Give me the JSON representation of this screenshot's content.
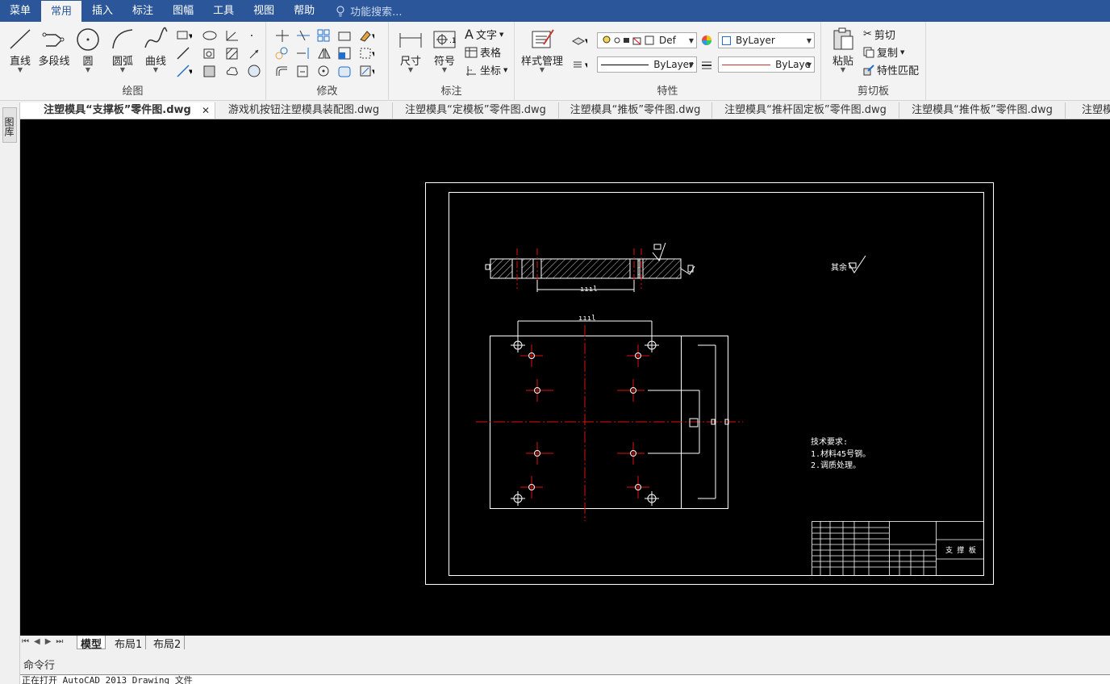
{
  "menubar": {
    "items": [
      "菜单",
      "常用",
      "插入",
      "标注",
      "图幅",
      "工具",
      "视图",
      "帮助"
    ],
    "search_placeholder": "功能搜索..."
  },
  "ribbon": {
    "draw": {
      "title": "绘图",
      "line": "直线",
      "polyline": "多段线",
      "circle": "圆",
      "arc": "圆弧",
      "curve": "曲线"
    },
    "modify": {
      "title": "修改"
    },
    "annotate": {
      "title": "标注",
      "dimension": "尺寸",
      "symbol": "符号",
      "text": "文字",
      "table": "表格",
      "coordinate": "坐标"
    },
    "properties": {
      "title": "特性",
      "style_manager": "样式管理",
      "layer_name": "Def",
      "bylayer1": "ByLayer",
      "bylayer2": "ByLayer",
      "bylayer3": "ByLaye"
    },
    "clipboard": {
      "title": "剪切板",
      "paste": "粘贴",
      "cut": "剪切",
      "copy": "复制",
      "match": "特性匹配"
    }
  },
  "tabs": [
    "注塑模具“支撑板”零件图.dwg",
    "游戏机按钮注塑模具装配图.dwg",
    "注塑模具“定模板”零件图.dwg",
    "注塑模具“推板”零件图.dwg",
    "注塑模具“推杆固定板”零件图.dwg",
    "注塑模具“推件板”零件图.dwg",
    "注塑模"
  ],
  "left_strip_label": "图库",
  "drawing": {
    "tech_title": "技术要求:",
    "tech_line1": "1.材料45号钢。",
    "tech_line2": "2.调质处理。",
    "part_name": "支 撑 板",
    "other_label": "其余"
  },
  "layout_tabs": [
    "模型",
    "布局1",
    "布局2"
  ],
  "command": {
    "label": "命令行",
    "output": "正在打开 AutoCAD 2013 Drawing 文件"
  }
}
